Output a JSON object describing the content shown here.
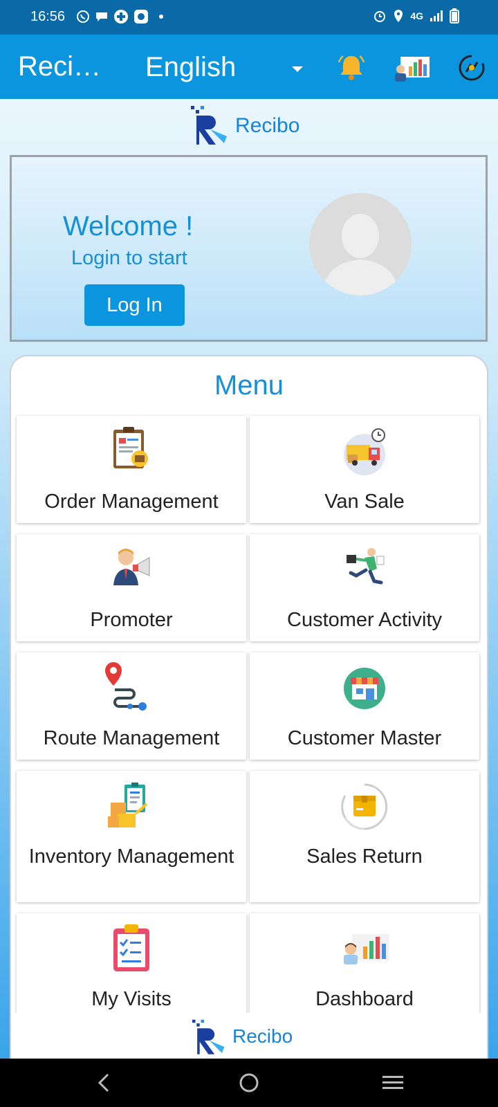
{
  "status_bar": {
    "time": "16:56",
    "network": "4G",
    "left_icons": [
      "whatsapp-icon",
      "chat-icon",
      "game-icon",
      "messenger-icon"
    ],
    "right_icons": [
      "alarm-icon",
      "location-icon",
      "signal-icon",
      "battery-icon"
    ]
  },
  "app_bar": {
    "title": "Reci…",
    "language": "English",
    "actions": [
      "notification-bell-icon",
      "analytics-report-icon",
      "sync-icon"
    ]
  },
  "brand": {
    "logo_text": "Recibo"
  },
  "welcome": {
    "title": "Welcome !",
    "subtitle": "Login to start",
    "login_label": "Log In"
  },
  "menu": {
    "title": "Menu",
    "items": [
      {
        "label": "Order Management",
        "icon": "clipboard-order-icon"
      },
      {
        "label": "Van Sale",
        "icon": "delivery-van-icon"
      },
      {
        "label": "Promoter",
        "icon": "promoter-megaphone-icon"
      },
      {
        "label": "Customer Activity",
        "icon": "running-businessman-icon"
      },
      {
        "label": "Route Management",
        "icon": "route-pin-icon"
      },
      {
        "label": "Customer Master",
        "icon": "storefront-icon"
      },
      {
        "label": "Inventory Management",
        "icon": "inventory-boxes-icon"
      },
      {
        "label": "Sales Return",
        "icon": "return-box-icon"
      },
      {
        "label": "My Visits",
        "icon": "visit-checklist-icon"
      },
      {
        "label": "Dashboard",
        "icon": "dashboard-chart-icon"
      }
    ]
  },
  "footer": {
    "logo_text": "Recibo"
  },
  "colors": {
    "primary": "#0b95de",
    "status_bar": "#0a6aa8",
    "accent_text": "#1490d6"
  }
}
